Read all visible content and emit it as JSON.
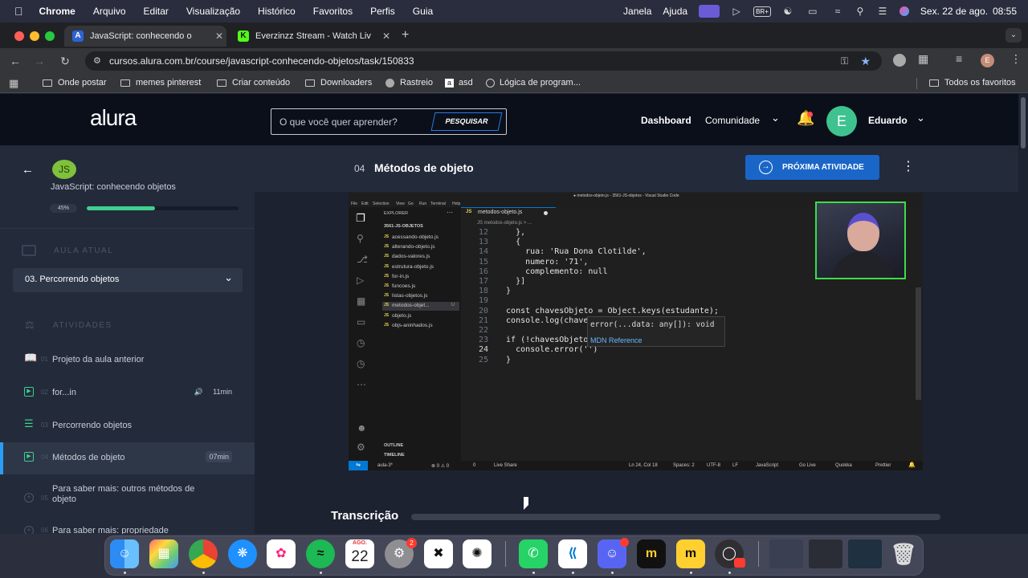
{
  "menubar": {
    "items": [
      "Chrome",
      "Arquivo",
      "Editar",
      "Visualização",
      "Histórico",
      "Favoritos",
      "Perfis",
      "Guia",
      "Janela",
      "Ajuda"
    ],
    "date": "Sex. 22 de ago.",
    "time": "08:55",
    "input_lang": "BR+"
  },
  "tabs": [
    {
      "title": "JavaScript: conhecendo o",
      "active": true,
      "favicon": "A"
    },
    {
      "title": "Everzinzz Stream - Watch Liv",
      "active": false,
      "favicon": "K"
    }
  ],
  "browser": {
    "url": "cursos.alura.com.br/course/javascript-conhecendo-objetos/task/150833",
    "profile_initial": "E",
    "bookmarks": [
      "Onde postar",
      "memes pinterest",
      "Criar conteúdo",
      "Downloaders",
      "Rastreio",
      "asd",
      "Lógica de program..."
    ],
    "all_bookmarks": "Todos os favoritos"
  },
  "site": {
    "logo": "alura",
    "search_placeholder": "O que você quer aprender?",
    "search_button": "PESQUISAR",
    "nav_dashboard": "Dashboard",
    "nav_community": "Comunidade",
    "user_initial": "E",
    "user_name": "Eduardo"
  },
  "sidebar": {
    "course_badge": "JS",
    "course_title": "JavaScript: conhecendo objetos",
    "progress_label": "45%",
    "progress": 0.45,
    "section_current": "AULA ATUAL",
    "current_lesson": "03. Percorrendo objetos",
    "section_activities": "ATIVIDADES",
    "activities": [
      {
        "num": "01",
        "label": "Projeto da aula anterior",
        "duration": "",
        "icon": "book-icon"
      },
      {
        "num": "02",
        "label": "for...in",
        "duration": "11min",
        "icon": "play-icon"
      },
      {
        "num": "03",
        "label": "Percorrendo objetos",
        "duration": "",
        "icon": "list-icon"
      },
      {
        "num": "04",
        "label": "Métodos de objeto",
        "duration": "07min",
        "icon": "play-icon"
      },
      {
        "num": "05",
        "label": "Para saber mais: outros métodos de objeto",
        "duration": "",
        "icon": "plus-icon"
      },
      {
        "num": "06",
        "label": "Para saber mais: propriedade",
        "duration": "",
        "icon": "plus-icon"
      }
    ]
  },
  "lesson": {
    "number": "04",
    "title": "Métodos de objeto",
    "next_button": "PRÓXIMA ATIVIDADE",
    "transcript": "Transcrição"
  },
  "vscode": {
    "menu": [
      "File",
      "Edit",
      "Selection",
      "View",
      "Go",
      "Run",
      "Terminal",
      "Help"
    ],
    "window_title": "● metodos-objeto.js - 3561-JS-objetos - Visual Studio Code",
    "explorer": "EXPLORER",
    "folder": "3561-JS-OBJETOS",
    "files": [
      "acessando-objeto.js",
      "alterando-objeto.js",
      "dados-valores.js",
      "estrutura-objeto.js",
      "for-in.js",
      "funcoes.js",
      "listas-objetos.js",
      "metodos-objet...",
      "objeto.js",
      "objs-aninhados.js"
    ],
    "active_tab": "metodos-objeto.js",
    "breadcrumb": "JS metodos-objeto.js > ...",
    "outline": "OUTLINE",
    "timeline": "TIMELINE",
    "code_lines": [
      {
        "n": "12",
        "t": "    },"
      },
      {
        "n": "13",
        "t": "    {"
      },
      {
        "n": "14",
        "t": "      rua: 'Rua Dona Clotilde',"
      },
      {
        "n": "15",
        "t": "      numero: '71',"
      },
      {
        "n": "16",
        "t": "      complemento: null"
      },
      {
        "n": "17",
        "t": "    }]"
      },
      {
        "n": "18",
        "t": "  }"
      },
      {
        "n": "19",
        "t": ""
      },
      {
        "n": "20",
        "t": "  const chavesObjeto = Object.keys(estudante);"
      },
      {
        "n": "21",
        "t": "  console.log(chave"
      },
      {
        "n": "22",
        "t": ""
      },
      {
        "n": "23",
        "t": "  if (!chavesObjeto"
      },
      {
        "n": "24",
        "t": "    console.error('')"
      },
      {
        "n": "25",
        "t": "  }"
      }
    ],
    "hint_signature": "error(...data: any[]): void",
    "hint_link": "MDN Reference",
    "status_branch": "aula-3*",
    "status_problems": "⊗ 0  ⚠ 0",
    "status_ports": "0",
    "status_liveshare": "Live Share",
    "status_pos": "Ln 24, Col 18",
    "status_spaces": "Spaces: 2",
    "status_encoding": "UTF-8",
    "status_eol": "LF",
    "status_lang": "JavaScript",
    "status_golive": "Go Live",
    "status_quokka": "Quokka",
    "status_prettier": "Prettier"
  },
  "dock": {
    "calendar_month": "AGO.",
    "calendar_day": "22",
    "settings_badge": "2"
  }
}
